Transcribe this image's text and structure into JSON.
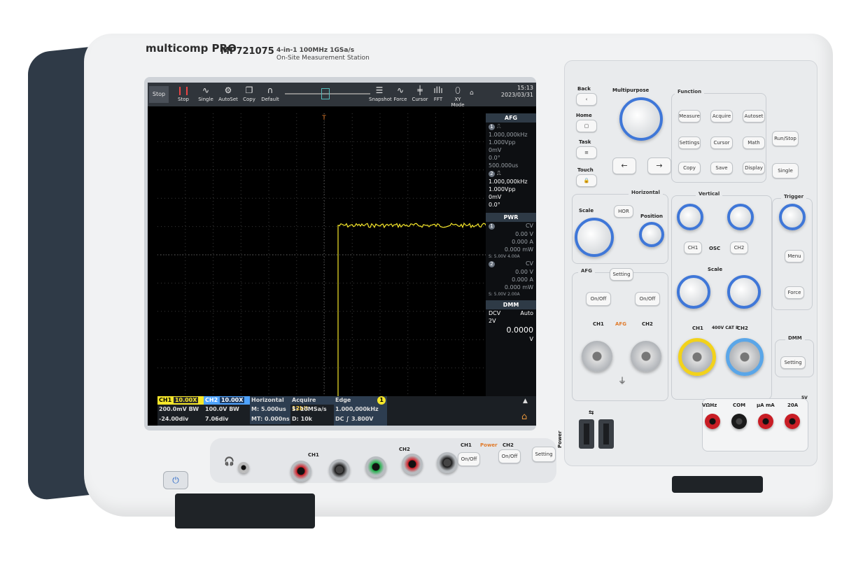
{
  "brand": {
    "logo": "multicomp PRO",
    "model": "MP721075",
    "spec_line1": "4-in-1   100MHz   1GSa/s",
    "spec_line2": "On-Site Measurement Station"
  },
  "toolbar": {
    "stop_status": "Stop",
    "buttons": [
      "Stop",
      "Single",
      "AutoSet",
      "Copy",
      "Default",
      "Snapshot",
      "Force",
      "Cursor",
      "FFT",
      "XY Mode"
    ],
    "time": "15:13",
    "date": "2023/03/31",
    "trigger_marker": "T"
  },
  "afg_panel": {
    "title": "AFG",
    "ch1": {
      "num": "1",
      "freq": "1.000,000kHz",
      "amp": "1.000Vpp",
      "offset": "0mV",
      "phase": "0.0°",
      "period": "500.000us"
    },
    "ch2": {
      "num": "2",
      "freq": "1.000,000kHz",
      "amp": "1.000Vpp",
      "offset": "0mV",
      "phase": "0.0°"
    }
  },
  "pwr_panel": {
    "title": "PWR",
    "ch1": {
      "num": "1",
      "mode": "CV",
      "v": "0.00 V",
      "a": "0.000 A",
      "w": "0.000 mW",
      "set": "S: 5.00V 4.00A"
    },
    "ch2": {
      "num": "2",
      "mode": "CV",
      "v": "0.00 V",
      "a": "0.000 A",
      "w": "0.000 mW",
      "set": "S: 5.00V 2.00A"
    }
  },
  "dmm_panel": {
    "title": "DMM",
    "mode": "DCV",
    "range_mode": "Auto",
    "range": "2V",
    "value": "0.0000",
    "unit": "V"
  },
  "status_bar": {
    "ch1": {
      "label": "CH1",
      "probe": "10.00X",
      "scale": "200.0mV",
      "bw": "BW",
      "offset": "-24.00div"
    },
    "ch2": {
      "label": "CH2",
      "probe": "10.00X",
      "scale": "100.0V",
      "bw": "BW",
      "offset": "7.06div"
    },
    "horizontal": {
      "label": "Horizontal",
      "main": "M: 5.000us",
      "mt": "MT: 0.000ns"
    },
    "acquire": {
      "label": "Acquire",
      "bits": "12bit",
      "rate": "S: 10MSa/s",
      "depth": "D: 10k"
    },
    "edge": {
      "label": "Edge",
      "ch": "1",
      "freq": "1.000,000kHz",
      "level": "DC ∫ 3.800V"
    }
  },
  "front_panel": {
    "back": "Back",
    "home": "Home",
    "task": "Task",
    "touch": "Touch",
    "multipurpose": "Multipurpose",
    "function_title": "Function",
    "function_keys": [
      "Measure",
      "Acquire",
      "Autoset",
      "Settings",
      "Cursor",
      "Math",
      "Copy",
      "Save",
      "Display"
    ],
    "run_stop": "Run/Stop",
    "single": "Single",
    "horizontal_title": "Horizontal",
    "scale": "Scale",
    "hor": "HOR",
    "position": "Position",
    "vertical_title": "Vertical",
    "osc": "OSC",
    "ch1": "CH1",
    "ch2": "CH2",
    "trigger_title": "Trigger",
    "menu": "Menu",
    "force": "Force",
    "afg_title": "AFG",
    "afg_setting": "Setting",
    "on_off": "On/Off",
    "afg_ch1": "CH1",
    "afg_ch2": "CH2",
    "afg_label": "AFG",
    "cat": "400V CAT Ⅱ",
    "dmm_title": "DMM",
    "dmm_setting": "Setting",
    "dmm_jacks": [
      "VΩHz",
      "COM",
      "µA mA",
      "20A"
    ],
    "power_label": "Power",
    "power_ch1": "CH1",
    "power_ch2": "CH2",
    "power_setting": "Setting",
    "front_ch1": "CH1",
    "front_ch2": "CH2",
    "usb_symbol": "⇆",
    "five_v": "5V"
  },
  "colors": {
    "ch1": "#f5e62a",
    "ch2": "#4fa3ff",
    "accent": "#3f77d8"
  }
}
